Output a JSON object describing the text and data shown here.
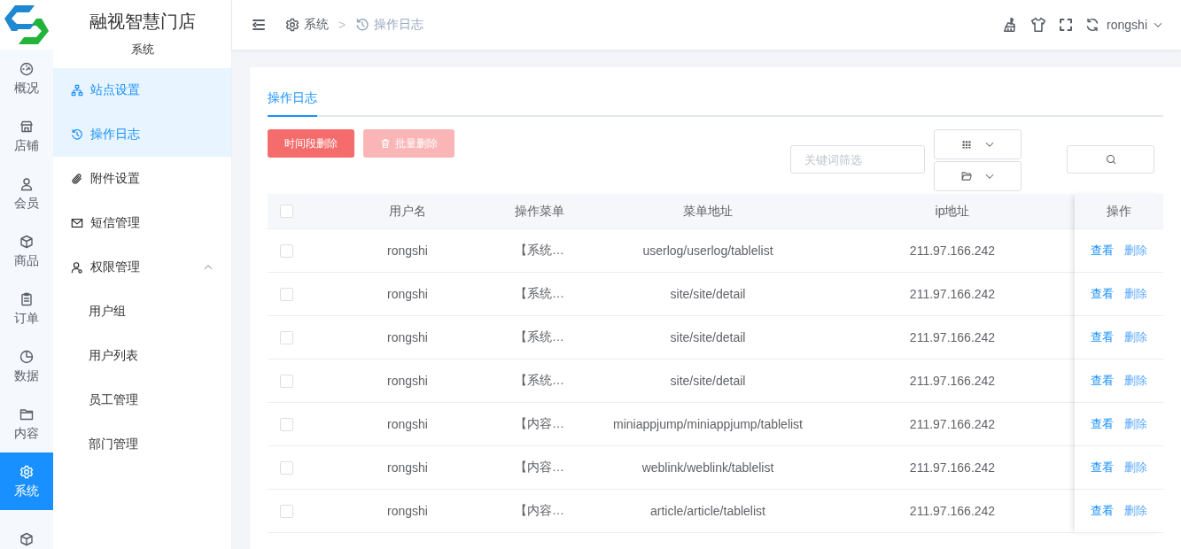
{
  "rail": {
    "items": [
      {
        "label": "概况",
        "selected": false
      },
      {
        "label": "店铺",
        "selected": false
      },
      {
        "label": "会员",
        "selected": false
      },
      {
        "label": "商品",
        "selected": false
      },
      {
        "label": "订单",
        "selected": false
      },
      {
        "label": "数据",
        "selected": false
      },
      {
        "label": "内容",
        "selected": false
      },
      {
        "label": "系统",
        "selected": true
      },
      {
        "selected": false
      }
    ]
  },
  "sidebar": {
    "title": "融视智慧门店",
    "section": "系统",
    "items": [
      {
        "label": "站点设置",
        "selected": true
      },
      {
        "label": "操作日志",
        "selected": true
      },
      {
        "label": "附件设置",
        "selected": false
      },
      {
        "label": "短信管理",
        "selected": false
      },
      {
        "label": "权限管理",
        "selected": false,
        "expanded": true,
        "children": [
          {
            "label": "用户组",
            "selected": false
          },
          {
            "label": "用户列表",
            "selected": false
          },
          {
            "label": "员工管理",
            "selected": false
          },
          {
            "label": "部门管理",
            "selected": false
          }
        ]
      }
    ]
  },
  "header": {
    "breadcrumb": [
      "系统",
      "操作日志"
    ],
    "separator": ">",
    "user": "rongshi"
  },
  "tabs": [
    {
      "label": "操作日志",
      "selected": true
    }
  ],
  "toolbar": {
    "buttons": [
      {
        "label": "时间段删除",
        "disabled": false
      },
      {
        "label": "批量删除",
        "disabled": true
      }
    ],
    "search": {
      "placeholder": "关键词筛选"
    }
  },
  "table": {
    "select_all": {
      "checked": false
    },
    "columns": [
      "用户名",
      "操作菜单",
      "菜单地址",
      "ip地址"
    ],
    "action_column": "操作",
    "rows": [
      {
        "checked": false,
        "cells": [
          "rongshi",
          "【系统…",
          "userlog/userlog/tablelist",
          "211.97.166.242"
        ],
        "actions": [
          "查看",
          "删除"
        ]
      },
      {
        "checked": false,
        "cells": [
          "rongshi",
          "【系统…",
          "site/site/detail",
          "211.97.166.242"
        ],
        "actions": [
          "查看",
          "删除"
        ]
      },
      {
        "checked": false,
        "cells": [
          "rongshi",
          "【系统…",
          "site/site/detail",
          "211.97.166.242"
        ],
        "actions": [
          "查看",
          "删除"
        ]
      },
      {
        "checked": false,
        "cells": [
          "rongshi",
          "【系统…",
          "site/site/detail",
          "211.97.166.242"
        ],
        "actions": [
          "查看",
          "删除"
        ]
      },
      {
        "checked": false,
        "cells": [
          "rongshi",
          "【内容…",
          "miniappjump/miniappjump/tablelist",
          "211.97.166.242"
        ],
        "actions": [
          "查看",
          "删除"
        ]
      },
      {
        "checked": false,
        "cells": [
          "rongshi",
          "【内容…",
          "weblink/weblink/tablelist",
          "211.97.166.242"
        ],
        "actions": [
          "查看",
          "删除"
        ]
      },
      {
        "checked": false,
        "cells": [
          "rongshi",
          "【内容…",
          "article/article/tablelist",
          "211.97.166.242"
        ],
        "actions": [
          "查看",
          "删除"
        ]
      }
    ]
  }
}
